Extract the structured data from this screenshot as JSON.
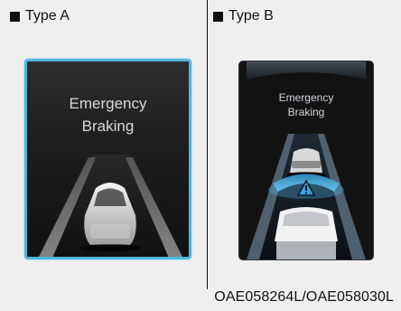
{
  "panels": {
    "type_a": {
      "label": "Type A",
      "message_line1": "Emergency",
      "message_line2": "Braking"
    },
    "type_b": {
      "label": "Type B",
      "message_line1": "Emergency",
      "message_line2": "Braking"
    }
  },
  "image_code": "OAE058264L/OAE058030L",
  "colors": {
    "frame_accent": "#4fb6df",
    "warning_blue": "#3aa4d8",
    "background": "#efefef"
  },
  "icons": {
    "warning": "warning-triangle-icon"
  }
}
